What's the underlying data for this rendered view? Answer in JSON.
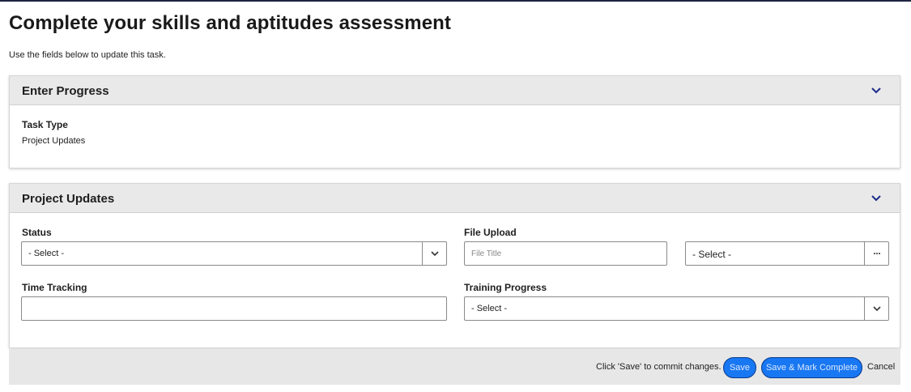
{
  "page": {
    "title": "Complete your skills and aptitudes assessment",
    "subtitle": "Use the fields below to update this task."
  },
  "enter_progress": {
    "title": "Enter Progress",
    "task_type_label": "Task Type",
    "task_type_value": "Project Updates"
  },
  "project_updates": {
    "title": "Project Updates",
    "status_label": "Status",
    "status_value": "- Select -",
    "file_upload_label": "File Upload",
    "file_title_placeholder": "File Title",
    "file_type_value": "- Select -",
    "time_tracking_label": "Time Tracking",
    "time_tracking_value": "",
    "training_progress_label": "Training Progress",
    "training_progress_value": "- Select -"
  },
  "footer": {
    "hint": "Click 'Save' to commit changes.",
    "save_label": "Save",
    "save_complete_label": "Save & Mark Complete",
    "cancel_label": "Cancel"
  },
  "colors": {
    "accent": "#1877f2",
    "chevron": "#1a2a8a",
    "header_bg": "#e9e9e9"
  },
  "icons": {
    "panel_toggle": "chevron-down-icon",
    "select_toggle": "chevron-down-icon",
    "file_browse": "ellipsis-icon"
  }
}
